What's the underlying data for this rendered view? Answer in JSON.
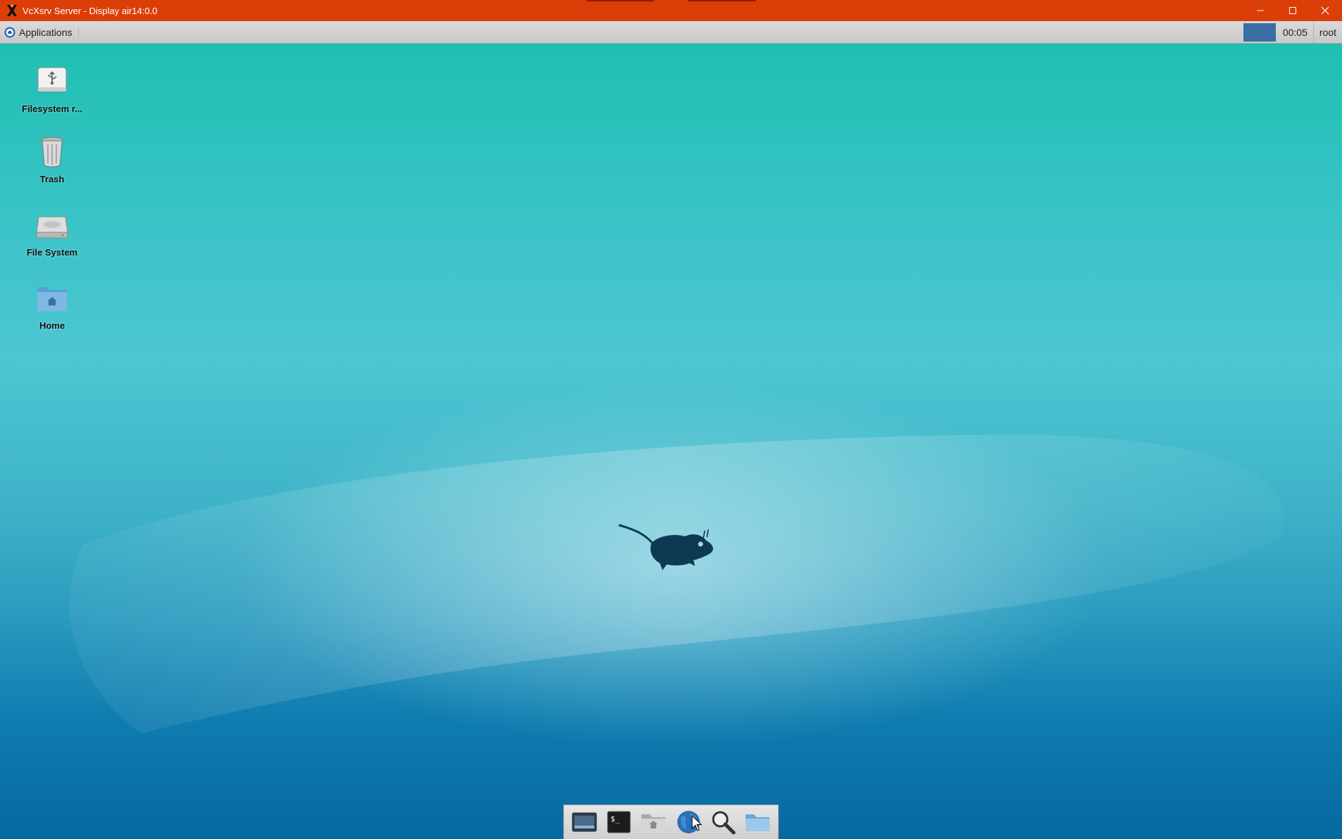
{
  "window": {
    "title": "VcXsrv Server - Display air14:0.0",
    "controls": [
      "minimize",
      "maximize",
      "close"
    ]
  },
  "panel": {
    "applications_label": "Applications",
    "clock": "00:05",
    "user": "root"
  },
  "desktop_icons": [
    {
      "label": "Filesystem r...",
      "icon": "usb-drive-icon"
    },
    {
      "label": "Trash",
      "icon": "trash-icon"
    },
    {
      "label": "File System",
      "icon": "hard-drive-icon"
    },
    {
      "label": "Home",
      "icon": "home-folder-icon"
    }
  ],
  "dock": {
    "items": [
      "show-desktop-icon",
      "terminal-icon",
      "home-folder-icon",
      "web-browser-icon",
      "search-icon",
      "folder-icon"
    ]
  },
  "colors": {
    "titlebar": "#dc3e08",
    "workspace": "#3a6ea5",
    "mouse_logo": "#0d3a52"
  }
}
